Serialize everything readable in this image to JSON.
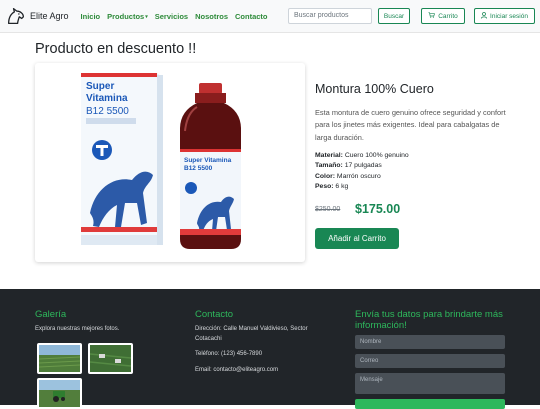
{
  "brand": {
    "name": "Elite Agro",
    "logo_icon": "horse-head-icon"
  },
  "nav": {
    "items": [
      {
        "label": "Inicio"
      },
      {
        "label": "Productos",
        "caret": "▾"
      },
      {
        "label": "Servicios"
      },
      {
        "label": "Nosotros"
      },
      {
        "label": "Contacto"
      }
    ],
    "search_placeholder": "Buscar productos",
    "search_button": "Buscar",
    "cart_button": "Carrito",
    "cart_icon": "cart-icon",
    "login_button": "Iniciar sesión",
    "login_icon": "user-icon"
  },
  "page": {
    "title": "Producto en descuento !!"
  },
  "product": {
    "image": {
      "box_line1": "Super",
      "box_line2": "Vitamina",
      "box_line3": "B12 5500",
      "bottle_line1": "Super Vitamina",
      "bottle_line2": "B12 5500"
    },
    "name": "Montura 100% Cuero",
    "description": "Esta montura de cuero genuino ofrece seguridad y confort para los jinetes más exigentes. Ideal para cabalgatas de larga duración.",
    "specs": [
      {
        "label": "Material:",
        "value": "Cuero 100% genuino"
      },
      {
        "label": "Tamaño:",
        "value": "17 pulgadas"
      },
      {
        "label": "Color:",
        "value": "Marrón oscuro"
      },
      {
        "label": "Peso:",
        "value": "6 kg"
      }
    ],
    "old_price": "$250.00",
    "new_price": "$175.00",
    "add_to_cart": "Añadir al Carrito"
  },
  "footer": {
    "gallery": {
      "title": "Galería",
      "subtitle": "Explora nuestras mejores fotos."
    },
    "contact": {
      "title": "Contacto",
      "address": "Dirección: Calle Manuel Valdivieso, Sector Cotacachi",
      "phone": "Teléfono: (123) 456-7890",
      "email": "Email: contacto@eliteagro.com"
    },
    "form": {
      "title": "Envía tus datos para brindarte más información!",
      "name_placeholder": "Nombre",
      "email_placeholder": "Correo",
      "message_placeholder": "Mensaje"
    }
  },
  "colors": {
    "accent": "#198754",
    "nav_link": "#2e8b3a",
    "footer_bg": "#212529",
    "footer_title": "#2eb85c"
  }
}
